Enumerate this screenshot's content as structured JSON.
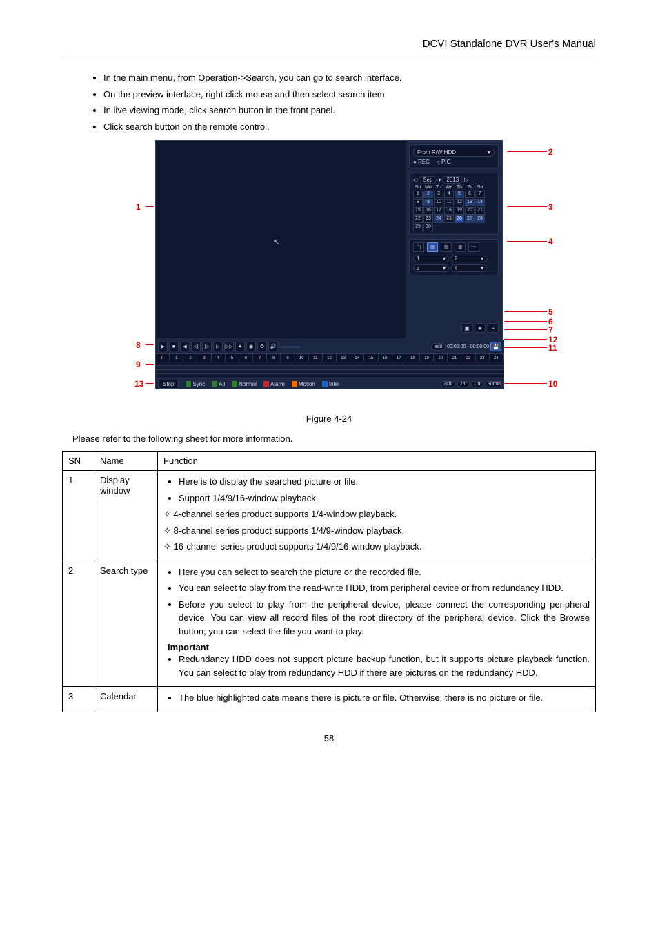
{
  "header": {
    "title": "DCVI Standalone DVR User's Manual"
  },
  "intro_bullets": [
    "In the main menu, from Operation->Search, you can go to search interface.",
    "On the preview interface, right click mouse and then select search item.",
    "In live viewing mode, click search button in the front panel.",
    "Click search button on the remote control."
  ],
  "figure": {
    "source_box": {
      "label": "From R/W HDD",
      "rec": "REC",
      "pic": "PIC"
    },
    "calendar": {
      "month": "Sep",
      "year": "2013",
      "dow": [
        "Su",
        "Mo",
        "Tu",
        "We",
        "Th",
        "Fr",
        "Sa"
      ],
      "days": [
        [
          "1",
          "2",
          "3",
          "4",
          "5",
          "6",
          "7"
        ],
        [
          "8",
          "9",
          "10",
          "11",
          "12",
          "13",
          "14"
        ],
        [
          "15",
          "16",
          "17",
          "18",
          "19",
          "20",
          "21"
        ],
        [
          "22",
          "23",
          "24",
          "25",
          "26",
          "27",
          "28"
        ],
        [
          "29",
          "30",
          "",
          "",
          "",
          "",
          ""
        ]
      ],
      "highlighted": [
        "2",
        "5",
        "9",
        "13",
        "14",
        "24",
        "26",
        "27",
        "28"
      ],
      "selected": "26"
    },
    "channel_selects": [
      "1",
      "2",
      "3",
      "4"
    ],
    "mark_buttons": [
      "tag",
      "bookmark",
      "list"
    ],
    "playback": {
      "buttons": [
        "play",
        "stop",
        "back",
        "frame-prev",
        "frame-next",
        "slow",
        "fast",
        "snap",
        "rec",
        "smart",
        "vol-mute"
      ],
      "edit_label": "edit",
      "time_a": "00:00:00",
      "time_b": "00:00:00",
      "save_icon": "💾"
    },
    "ruler_hours": [
      "0",
      "1",
      "2",
      "3",
      "4",
      "5",
      "6",
      "7",
      "8",
      "9",
      "10",
      "11",
      "12",
      "13",
      "14",
      "15",
      "16",
      "17",
      "18",
      "19",
      "20",
      "21",
      "22",
      "23",
      "24"
    ],
    "typebar": {
      "stop": "Stop",
      "sync": "Sync",
      "all": "All",
      "normal": "Normal",
      "alarm": "Alarm",
      "motion": "Motion",
      "intel": "Intel",
      "zoom": [
        "24hr",
        "2hr",
        "1hr",
        "30min"
      ]
    },
    "callouts": {
      "1": "1",
      "2": "2",
      "3": "3",
      "4": "4",
      "5": "5",
      "6": "6",
      "7": "7",
      "8": "8",
      "9": "9",
      "10": "10",
      "11": "11",
      "12": "12",
      "13": "13"
    },
    "caption": "Figure 4-24"
  },
  "desc_line": "Please refer to the following sheet for more information.",
  "table": {
    "headers": [
      "SN",
      "Name",
      "Function"
    ],
    "rows": [
      {
        "sn": "1",
        "name": "Display window",
        "bullets": [
          "Here is to display the searched picture or file.",
          "Support 1/4/9/16-window playback."
        ],
        "diamonds": [
          "4-channel series product supports 1/4-window playback.",
          "8-channel series product supports 1/4/9-window playback.",
          "16-channel series product supports 1/4/9/16-window playback."
        ]
      },
      {
        "sn": "2",
        "name": "Search type",
        "bullets": [
          "Here you can select to search the picture or the recorded file.",
          "You can select to play from the read-write HDD, from peripheral device or from redundancy HDD.",
          "Before you select to play from the peripheral device, please connect the corresponding peripheral device. You can view all record files of the root directory of the peripheral device. Click the Browse button; you can select the file you want to play.",
          "Redundancy HDD does not support picture backup function, but it supports picture playback function. You can select to play from redundancy HDD if there are pictures on the redundancy HDD."
        ],
        "important_label": "Important"
      },
      {
        "sn": "3",
        "name": "Calendar",
        "bullets": [
          "The blue highlighted date means there is picture or file. Otherwise, there is no picture or file."
        ]
      }
    ]
  },
  "page_number": "58"
}
